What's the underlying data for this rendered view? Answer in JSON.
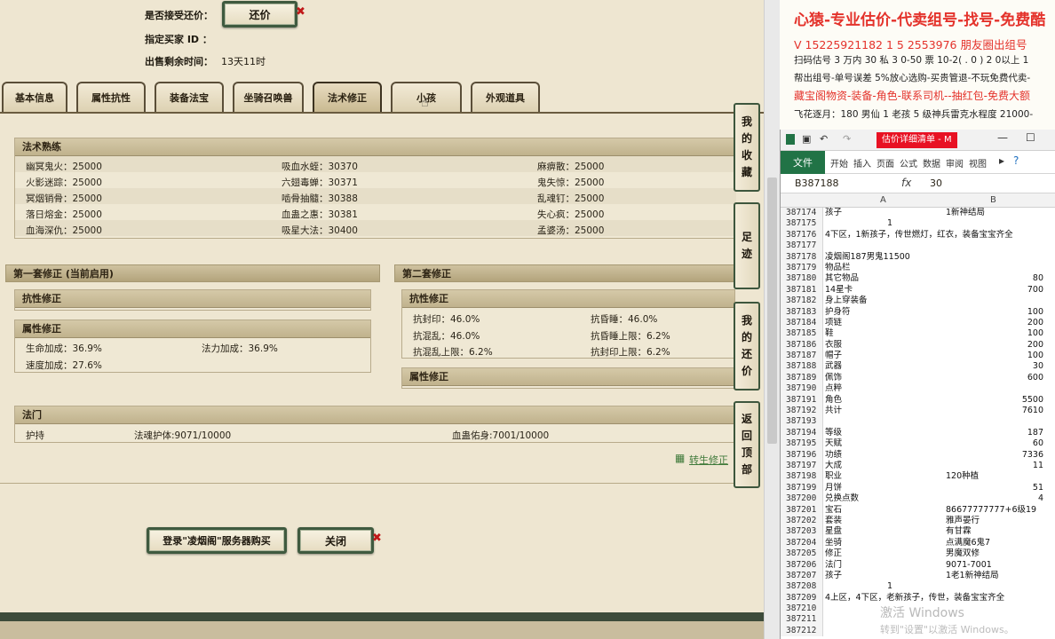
{
  "top": {
    "accept_label": "是否接受还价：",
    "accept_button": "还价",
    "buyer_label": "指定买家 ID ：",
    "remaining_label": "出售剩余时间：",
    "remaining_value": "13天11时"
  },
  "tabs": [
    "基本信息",
    "属性抗性",
    "装备法宝",
    "坐骑召唤兽",
    "法术修正",
    "小孩",
    "外观道具"
  ],
  "spell_mastery": {
    "title": "法术熟练",
    "rows": [
      [
        "幽冥鬼火：25000",
        "吸血水蛭：30370",
        "麻痹散：25000"
      ],
      [
        "火影迷踪：25000",
        "六翅毒蝉：30371",
        "鬼失惊：25000"
      ],
      [
        "冥烟销骨：25000",
        "啮骨抽髓：30388",
        "乱魂钉：25000"
      ],
      [
        "落日熔金：25000",
        "血蛊之惠：30381",
        "失心疯：25000"
      ],
      [
        "血海深仇：25000",
        "吸星大法：30400",
        "孟婆汤：25000"
      ]
    ]
  },
  "set1": {
    "title": "第一套修正 (当前启用)",
    "resist_title": "抗性修正",
    "attr_title": "属性修正",
    "attr_rows": [
      [
        "生命加成：36.9%",
        "法力加成：36.9%"
      ],
      [
        "速度加成：27.6%",
        ""
      ]
    ]
  },
  "set2": {
    "title": "第二套修正",
    "resist_title": "抗性修正",
    "resist_rows": [
      [
        "抗封印：46.0%",
        "抗昏睡：46.0%"
      ],
      [
        "抗混乱：46.0%",
        "抗昏睡上限：6.2%"
      ],
      [
        "抗混乱上限：6.2%",
        "抗封印上限：6.2%"
      ]
    ],
    "attr_title": "属性修正"
  },
  "fumen": {
    "title": "法门",
    "items": [
      "护持",
      "法魂护体:9071/10000",
      "血蛊佑身:7001/10000"
    ]
  },
  "transfer_link": "转生修正",
  "buy_button": "登录\"凌烟阁\"服务器购买",
  "close_button": "关闭",
  "side_buttons": [
    [
      "我",
      "的",
      "收",
      "藏"
    ],
    [
      "足",
      "迹"
    ],
    [
      "我",
      "的",
      "还",
      "价"
    ],
    [
      "返",
      "回",
      "顶",
      "部"
    ]
  ],
  "ads": [
    {
      "text": "心猿-专业估价-代卖组号-找号-免费酷",
      "color": "#e4322b"
    },
    {
      "text": "V 15225921182    1 5 2553976 朋友圈出组号",
      "color": "#e4322b"
    },
    {
      "text": "扫码估号 3 万内 30 私 3 0-50 票   10-2( . 0 ) 2 0以上 1",
      "color": "#222222"
    },
    {
      "text": "帮出组号-单号误差 5%放心选购-买贵管退-不玩免费代卖-",
      "color": "#222222"
    },
    {
      "text": "藏宝阁物资-装备-角色-联系司机--抽红包-免费大额",
      "color": "#e4322b"
    },
    {
      "text": "飞花逐月：180 男仙 1 老孩 5 级神兵雷克水程度 21000-",
      "color": "#222222"
    }
  ],
  "excel": {
    "title": "估价详细清单 - M",
    "ribbon_tabs": [
      "文件",
      "开始",
      "插入",
      "页面",
      "公式",
      "数据",
      "审阅",
      "视图"
    ],
    "name_box": "B387188",
    "formula_value": "30",
    "columns": [
      "A",
      "B"
    ],
    "rows": [
      [
        "387174",
        "孩子",
        "1新神结局",
        "l"
      ],
      [
        "387175",
        "1",
        "",
        "c"
      ],
      [
        "387176",
        "4下区，1新孩子，传世燃灯，红衣，装备宝宝齐全",
        "",
        "l"
      ],
      [
        "387177",
        "",
        "",
        "l"
      ],
      [
        "387178",
        "凌烟阁187男鬼11500",
        "",
        "l"
      ],
      [
        "387179",
        "物品栏",
        "",
        "l"
      ],
      [
        "387180",
        "其它物品",
        "80",
        "r"
      ],
      [
        "387181",
        "14星卡",
        "700",
        "r"
      ],
      [
        "387182",
        "身上穿装备",
        "",
        "l"
      ],
      [
        "387183",
        "护身符",
        "100",
        "r"
      ],
      [
        "387184",
        "项链",
        "200",
        "r"
      ],
      [
        "387185",
        "鞋",
        "100",
        "r"
      ],
      [
        "387186",
        "衣服",
        "200",
        "r"
      ],
      [
        "387187",
        "帽子",
        "100",
        "r"
      ],
      [
        "387188",
        "武器",
        "30",
        "r"
      ],
      [
        "387189",
        "佩饰",
        "600",
        "r"
      ],
      [
        "387190",
        "点粹",
        "",
        "l"
      ],
      [
        "387191",
        "角色",
        "5500",
        "r"
      ],
      [
        "387192",
        "共计",
        "7610",
        "r"
      ],
      [
        "387193",
        "",
        "",
        "l"
      ],
      [
        "387194",
        "等级",
        "187",
        "r"
      ],
      [
        "387195",
        "天赋",
        "60",
        "r"
      ],
      [
        "387196",
        "功绩",
        "7336",
        "r"
      ],
      [
        "387197",
        "大成",
        "11",
        "r"
      ],
      [
        "387198",
        "职业",
        "120种植",
        "l"
      ],
      [
        "387199",
        "月饼",
        "51",
        "r"
      ],
      [
        "387200",
        "兑换点数",
        "4",
        "r"
      ],
      [
        "387201",
        "宝石",
        "86677777777+6级19",
        "l"
      ],
      [
        "387202",
        "套装",
        "雅声晏行",
        "l"
      ],
      [
        "387203",
        "星盘",
        "有甘霖",
        "l"
      ],
      [
        "387204",
        "坐骑",
        "点满魔6鬼7",
        "l"
      ],
      [
        "387205",
        "修正",
        "男魔双修",
        "l"
      ],
      [
        "387206",
        "法门",
        "9071-7001",
        "l"
      ],
      [
        "387207",
        "孩子",
        "1老1新神结局",
        "l"
      ],
      [
        "387208",
        "1",
        "",
        "c"
      ],
      [
        "387209",
        "4上区，4下区，老新孩子，传世，装备宝宝齐全",
        "",
        "l"
      ],
      [
        "387210",
        "",
        "",
        "l"
      ],
      [
        "387211",
        "",
        "",
        "l"
      ],
      [
        "387212",
        "",
        "",
        "l"
      ]
    ],
    "watermark1": "激活 Windows",
    "watermark2": "转到\"设置\"以激活 Windows。"
  }
}
